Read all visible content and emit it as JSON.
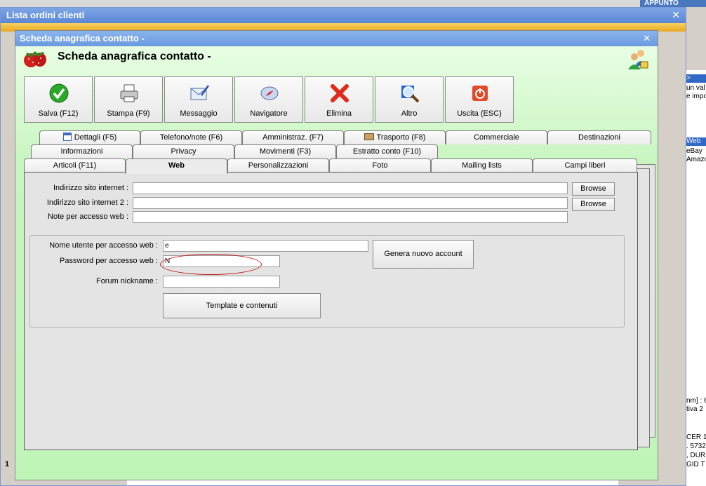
{
  "background": {
    "appunto_label": "APPUNTO",
    "right_texts": [
      ">",
      "un val",
      "e impo",
      "Web",
      "eBay",
      "Amazo",
      "nm] : 6",
      "tiva 2",
      "CER  1",
      ". 5732",
      ", DUR",
      "GID  T"
    ]
  },
  "lista_window": {
    "title": "Lista ordini clienti",
    "status_number": "1"
  },
  "scheda_window": {
    "title": "Scheda anagrafica contatto - ",
    "heading": "Scheda anagrafica contatto - "
  },
  "toolbar": {
    "buttons": [
      {
        "label": "Salva (F12)",
        "icon": "check-icon"
      },
      {
        "label": "Stampa (F9)",
        "icon": "printer-icon"
      },
      {
        "label": "Messaggio",
        "icon": "envelope-icon"
      },
      {
        "label": "Navigatore",
        "icon": "compass-icon"
      },
      {
        "label": "Elimina",
        "icon": "delete-x-icon"
      },
      {
        "label": "Altro",
        "icon": "magnifier-icon"
      },
      {
        "label": "Uscita (ESC)",
        "icon": "power-icon"
      }
    ]
  },
  "tabs": {
    "row1": [
      "Dettagli (F5)",
      "Telefono/note (F6)",
      "Amministraz. (F7)",
      "Trasporto (F8)",
      "Commerciale",
      "Destinazioni"
    ],
    "row2": [
      "Informazioni",
      "Privacy",
      "Movimenti (F3)",
      "Estratto conto (F10)"
    ],
    "row3": [
      "Articoli (F11)",
      "Web",
      "Personalizzazioni",
      "Foto",
      "Mailing lists",
      "Campi liberi"
    ],
    "active": "Web"
  },
  "web_form": {
    "site_label": "Indirizzo sito internet :",
    "site_value": "",
    "site2_label": "Indirizzo sito internet 2 :",
    "site2_value": "",
    "notes_label": "Note per accesso web :",
    "notes_value": "",
    "browse_label": "Browse",
    "username_label": "Nome utente per accesso web :",
    "username_value": "e",
    "password_label": "Password per accesso web :",
    "password_value": "N",
    "forum_label": "Forum nickname :",
    "forum_value": "",
    "generate_label": "Genera nuovo account",
    "template_label": "Template e contenuti"
  }
}
